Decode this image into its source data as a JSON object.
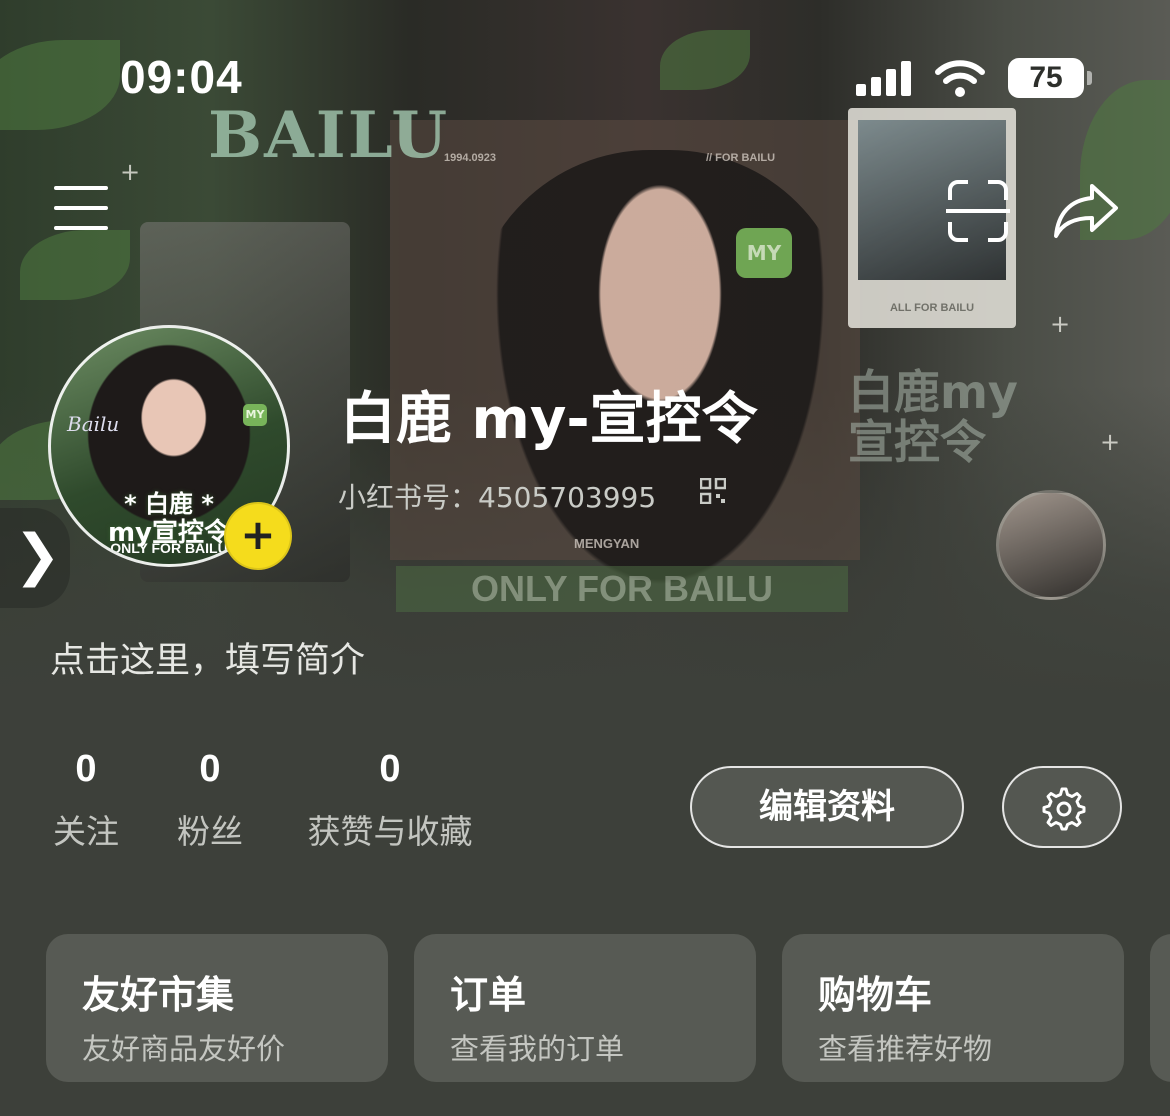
{
  "status_bar": {
    "time": "09:04",
    "battery": "75"
  },
  "background_art": {
    "title": "BAILU",
    "date": "1994.0923",
    "for": "// FOR BAILU",
    "tag": "MY",
    "polaroid_caption": "ALL FOR BAILU",
    "big_line1": "白鹿my",
    "big_line2": "宣控令",
    "banner": "ONLY FOR BAILU",
    "mengyan": "MENGYAN"
  },
  "avatar": {
    "script": "Bailu",
    "tag": "MY",
    "line1": "* 白鹿 *",
    "line2": "my宣控令",
    "line3": "ONLY FOR BAILU"
  },
  "profile": {
    "nickname": "白鹿 my-宣控令",
    "red_id": "小红书号：4505703995",
    "bio_placeholder": "点击这里，填写简介"
  },
  "stats": [
    {
      "value": "0",
      "label": "关注"
    },
    {
      "value": "0",
      "label": "粉丝"
    },
    {
      "value": "0",
      "label": "获赞与收藏"
    }
  ],
  "actions": {
    "edit_profile": "编辑资料"
  },
  "cards": [
    {
      "title": "友好市集",
      "subtitle": "友好商品友好价"
    },
    {
      "title": "订单",
      "subtitle": "查看我的订单"
    },
    {
      "title": "购物车",
      "subtitle": "查看推荐好物"
    }
  ],
  "colors": {
    "background": "#3d403a",
    "card": "#575a54",
    "accent_yellow": "#f5dc1c"
  }
}
